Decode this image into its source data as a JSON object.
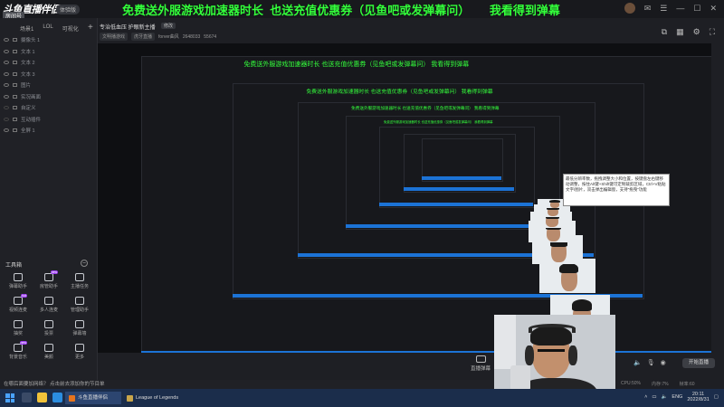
{
  "topbar": {
    "logo": "斗鱼直播伴侣",
    "logo_tag": "体验版",
    "room_badge": "房间号",
    "room_id": "2648033",
    "banner": "免费送外服游戏加速器时长  也送充值优惠券（见鱼吧或发弹幕问）      我看得到弹幕"
  },
  "sidebar": {
    "scene_tabs": [
      "场景1",
      "LOL",
      "可视化"
    ],
    "scene_add": "+",
    "sources": [
      {
        "label": "摄像头 1",
        "visible": true
      },
      {
        "label": "文本 1",
        "visible": true
      },
      {
        "label": "文本 2",
        "visible": true
      },
      {
        "label": "文本 3",
        "visible": true
      },
      {
        "label": "图片",
        "visible": true
      },
      {
        "label": "实况画面",
        "visible": true
      },
      {
        "label": "自定义",
        "visible": false
      },
      {
        "label": "互动插件",
        "visible": false
      },
      {
        "label": "全屏 1",
        "visible": true
      }
    ],
    "toolbox_title": "工具箱",
    "tools": [
      {
        "label": "弹幕助手",
        "hot": ""
      },
      {
        "label": "房管助手",
        "hot": "new"
      },
      {
        "label": "主播任务",
        "hot": ""
      },
      {
        "label": "视频连麦",
        "hot": "hot"
      },
      {
        "label": "多人连麦",
        "hot": ""
      },
      {
        "label": "管理助手",
        "hot": ""
      },
      {
        "label": "抽奖",
        "hot": ""
      },
      {
        "label": "投票",
        "hot": ""
      },
      {
        "label": "弹幕墙",
        "hot": ""
      },
      {
        "label": "背景音乐",
        "hot": "new"
      },
      {
        "label": "美颜",
        "hot": ""
      },
      {
        "label": "更多",
        "hot": ""
      }
    ]
  },
  "stage": {
    "stream_title": "专治低血压 护眼新主播",
    "edit_label": "修改",
    "chips": [
      "文明播游戏",
      "虎牙直播"
    ],
    "streamer": "forver曲风",
    "followers": "2648033",
    "viewers": "55674",
    "right_tools": [
      "layers-icon",
      "grid-icon",
      "settings-icon",
      "fullscreen-icon"
    ],
    "tooltip": "最低分辨率数，拖拽调整大小和位置，按键盘左右键移动调整，按住Alt键+Shift键可定制裁剪区域，Ctrl+V粘贴文字/图片，双击弹出编辑窗，支持“拖曳”功能",
    "inner_task": "League of Legends",
    "inner_stream": "斗鱼直播伴侣"
  },
  "bottom": {
    "quick_chat": "直播弹幕",
    "start_button": "开始直播",
    "notification": "在哪后面要加网络？ 点击前去添加你的节目单",
    "hud": [
      "CPU:50%",
      "内存:7%",
      "帧率:60"
    ]
  },
  "taskbar": {
    "tasks": [
      {
        "label": "斗鱼直播伴侣",
        "color": "#e8741c"
      },
      {
        "label": "League of Legends",
        "color": "#1b1b1b"
      }
    ],
    "lang": "ENG",
    "time": "20:11",
    "date": "2022/8/31"
  },
  "colors": {
    "banner": "#34ff3c",
    "taskbar": "#1b2d4b",
    "accent": "#1c73d6"
  }
}
